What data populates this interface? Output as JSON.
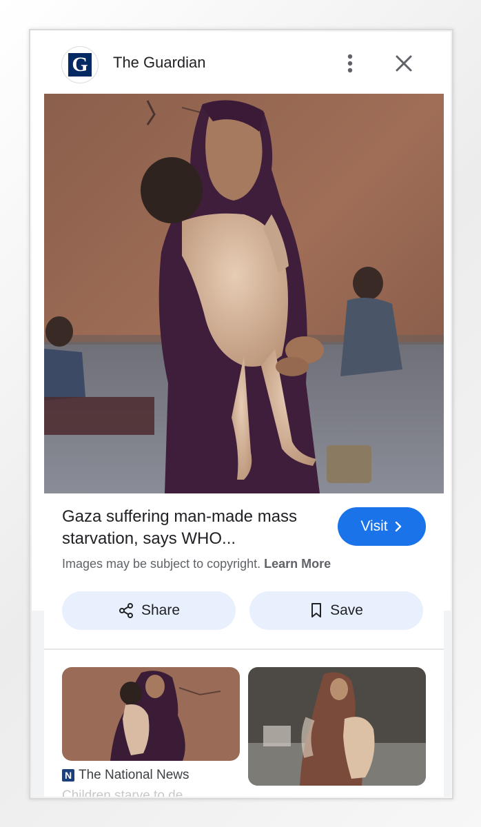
{
  "header": {
    "logo_letter": "G",
    "source_name": "The Guardian",
    "more_icon": "more-vert-icon",
    "close_icon": "close-icon"
  },
  "main_image": {
    "description_icon": "news-photo"
  },
  "caption": {
    "title": "Gaza suffering man-made mass starvation, says WHO...",
    "visit_label": "Visit",
    "copyright_text": "Images may be subject to copyright.",
    "learn_more": "Learn More"
  },
  "actions": {
    "share_label": "Share",
    "save_label": "Save"
  },
  "related": {
    "items": [
      {
        "source": "The National News",
        "source_icon_letter": "N",
        "snippet": "Children starve to de"
      },
      {
        "source": "",
        "snippet": ""
      }
    ]
  },
  "colors": {
    "accent": "#1a73e8",
    "action_bg": "#e8f0fe",
    "guardian_blue": "#052962"
  }
}
